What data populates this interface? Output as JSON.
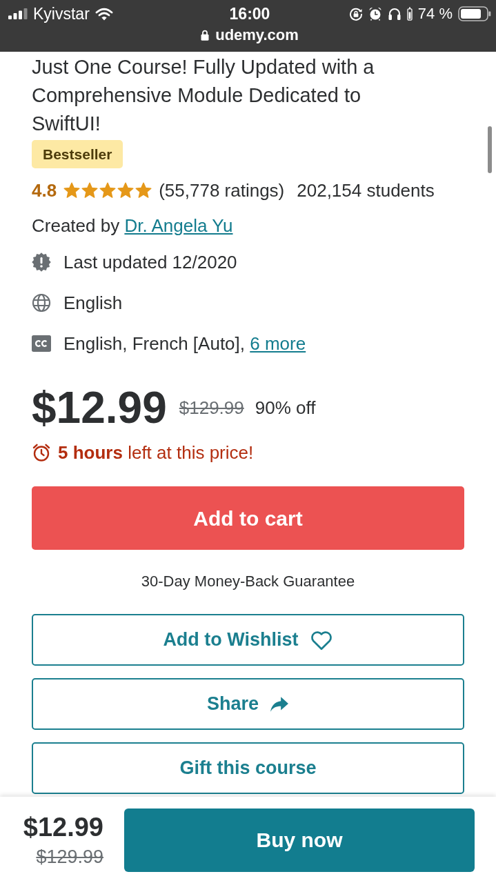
{
  "status_bar": {
    "carrier": "Kyivstar",
    "time": "16:00",
    "battery": "74 %",
    "url": "udemy.com"
  },
  "course": {
    "title": "Just One Course! Fully Updated with a Comprehensive Module Dedicated to SwiftUI!",
    "badge": "Bestseller",
    "rating": "4.8",
    "stars": 5,
    "ratings": "(55,778 ratings)",
    "students": "202,154 students",
    "created_by": {
      "label": "Created by",
      "author": "Dr. Angela Yu"
    }
  },
  "details": [
    {
      "kind": "updated",
      "text": "Last updated 12/2020"
    },
    {
      "kind": "language",
      "text": "English"
    },
    {
      "kind": "captions",
      "text": "English, French [Auto],",
      "link": "6 more"
    }
  ],
  "price": {
    "current": "$12.99",
    "original": "$129.99",
    "discount": "90% off",
    "countdown": "**5 hours** left at this price!"
  },
  "add_to_cart": "Add to cart",
  "guarantee": "30-Day Money-Back Guarantee",
  "actions": [
    {
      "kind": "wishlist",
      "label": "Add to Wishlist"
    },
    {
      "kind": "share",
      "label": "Share"
    },
    {
      "kind": "gift",
      "label": "Gift this course"
    }
  ],
  "bottom_bar": {
    "price": "$12.99",
    "original_price": "$129.99",
    "button": "Buy now"
  }
}
